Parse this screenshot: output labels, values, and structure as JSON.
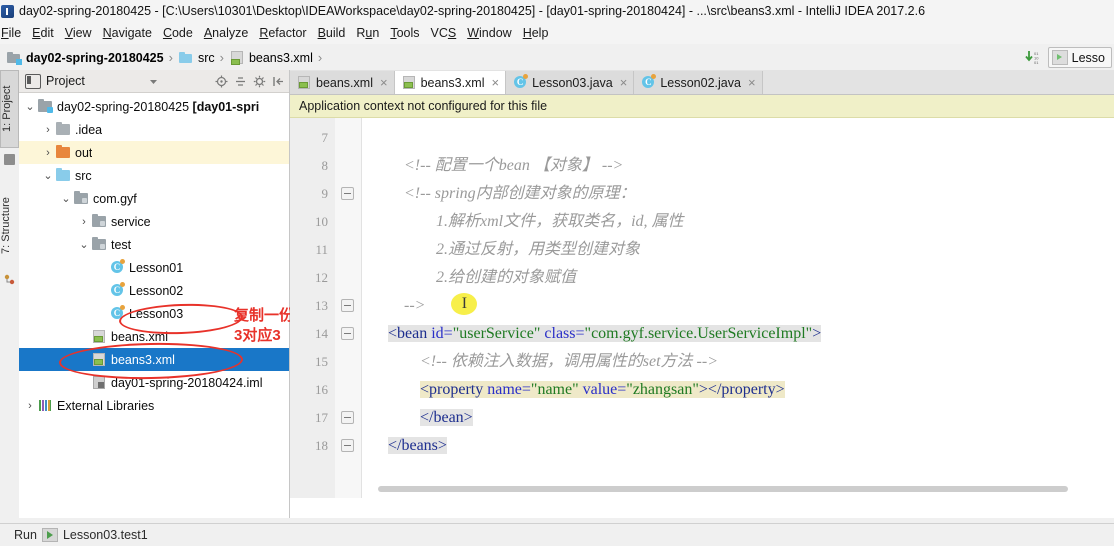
{
  "window": {
    "title": "day02-spring-20180425 - [C:\\Users\\10301\\Desktop\\IDEAWorkspace\\day02-spring-20180425] - [day01-spring-20180424] - ...\\src\\beans3.xml - IntelliJ IDEA 2017.2.6",
    "app_icon": "intellij-idea-icon"
  },
  "menubar": {
    "items": [
      {
        "label": "File",
        "mnemonic": "F"
      },
      {
        "label": "Edit",
        "mnemonic": "E"
      },
      {
        "label": "View",
        "mnemonic": "V"
      },
      {
        "label": "Navigate",
        "mnemonic": "N"
      },
      {
        "label": "Code",
        "mnemonic": "C"
      },
      {
        "label": "Analyze",
        "mnemonic": "A"
      },
      {
        "label": "Refactor",
        "mnemonic": "R"
      },
      {
        "label": "Build",
        "mnemonic": "B"
      },
      {
        "label": "Run",
        "mnemonic": "u"
      },
      {
        "label": "Tools",
        "mnemonic": "T"
      },
      {
        "label": "VCS",
        "mnemonic": "S"
      },
      {
        "label": "Window",
        "mnemonic": "W"
      },
      {
        "label": "Help",
        "mnemonic": "H"
      }
    ]
  },
  "navbar": {
    "crumbs": [
      {
        "label": "day02-spring-20180425",
        "icon": "module-icon",
        "bold": true
      },
      {
        "label": "src",
        "icon": "source-folder-icon",
        "bold": false
      },
      {
        "label": "beans3.xml",
        "icon": "xml-file-icon",
        "bold": false
      }
    ],
    "separator": "›",
    "run_config_label": "Lesso",
    "download_icon": "update-project-icon"
  },
  "left_strip": {
    "tabs": [
      {
        "label": "1: Project",
        "selected": true,
        "icon": "project-tool-icon"
      },
      {
        "label": "7: Structure",
        "selected": false,
        "icon": "structure-tool-icon"
      }
    ]
  },
  "project_panel": {
    "title": "Project",
    "title_icon": "project-view-icon",
    "dropdown_icon": "chevron-down-icon",
    "tools": [
      "locate-icon",
      "collapse-all-icon",
      "settings-gear-icon",
      "hide-panel-icon"
    ],
    "tree": [
      {
        "depth": 0,
        "arrow": "⌄",
        "icon": "module-icon",
        "label": "day02-spring-20180425 ",
        "bold_suffix": "[day01-spri",
        "state": "normal"
      },
      {
        "depth": 1,
        "arrow": "›",
        "icon": "folder-gray-icon",
        "label": ".idea",
        "state": "normal"
      },
      {
        "depth": 1,
        "arrow": "›",
        "icon": "folder-orange-icon",
        "label": "out",
        "state": "highlighted"
      },
      {
        "depth": 1,
        "arrow": "⌄",
        "icon": "folder-blue-icon",
        "label": "src",
        "state": "normal"
      },
      {
        "depth": 2,
        "arrow": "⌄",
        "icon": "package-icon",
        "label": "com.gyf",
        "state": "normal"
      },
      {
        "depth": 3,
        "arrow": "›",
        "icon": "package-icon",
        "label": "service",
        "state": "normal"
      },
      {
        "depth": 3,
        "arrow": "⌄",
        "icon": "package-icon",
        "label": "test",
        "state": "normal"
      },
      {
        "depth": 4,
        "arrow": "",
        "icon": "java-class-icon",
        "label": "Lesson01",
        "state": "normal"
      },
      {
        "depth": 4,
        "arrow": "",
        "icon": "java-class-icon",
        "label": "Lesson02",
        "state": "normal"
      },
      {
        "depth": 4,
        "arrow": "",
        "icon": "java-class-icon",
        "label": "Lesson03",
        "state": "normal"
      },
      {
        "depth": 3,
        "arrow": "",
        "icon": "xml-file-icon",
        "label": "beans.xml",
        "state": "normal"
      },
      {
        "depth": 3,
        "arrow": "",
        "icon": "xml-file-icon",
        "label": "beans3.xml",
        "state": "selected"
      },
      {
        "depth": 3,
        "arrow": "",
        "icon": "iml-file-icon",
        "label": "day01-spring-20180424.iml",
        "state": "normal"
      },
      {
        "depth": 0,
        "arrow": "›",
        "icon": "libraries-icon",
        "label": "External Libraries",
        "state": "normal"
      }
    ],
    "annotations": [
      {
        "text": "复制一份",
        "color": "#e8322a"
      },
      {
        "text": "3对应3",
        "color": "#e8322a"
      }
    ],
    "annotation_shapes": [
      "ellipse-around-lesson03",
      "ellipse-around-beans3xml"
    ]
  },
  "editor": {
    "tabs": [
      {
        "label": "beans.xml",
        "icon": "xml-file-icon",
        "active": false,
        "close": "×"
      },
      {
        "label": "beans3.xml",
        "icon": "xml-file-icon",
        "active": true,
        "close": "×"
      },
      {
        "label": "Lesson03.java",
        "icon": "java-class-icon",
        "active": false,
        "close": "×"
      },
      {
        "label": "Lesson02.java",
        "icon": "java-class-icon",
        "active": false,
        "close": "×"
      }
    ],
    "notice": "Application context not configured for this file",
    "notice_bg": "#f0f0c8",
    "line_numbers": [
      "7",
      "8",
      "9",
      "10",
      "11",
      "12",
      "13",
      "14",
      "15",
      "16",
      "17",
      "18"
    ],
    "lines": [
      {
        "num": "7",
        "indent": 0,
        "segments": []
      },
      {
        "num": "8",
        "indent": 2,
        "segments": [
          {
            "t": "<!-- 配置一个bean 【对象】 -->",
            "k": "com"
          }
        ]
      },
      {
        "num": "9",
        "indent": 2,
        "segments": [
          {
            "t": "<!-- spring内部创建对象的原理：",
            "k": "com"
          }
        ],
        "fold": true
      },
      {
        "num": "10",
        "indent": 4,
        "segments": [
          {
            "t": "1.解析xml文件，获取类名，id, 属性",
            "k": "com"
          }
        ]
      },
      {
        "num": "11",
        "indent": 4,
        "segments": [
          {
            "t": "2.通过反射，用类型创建对象",
            "k": "com"
          }
        ]
      },
      {
        "num": "12",
        "indent": 4,
        "segments": [
          {
            "t": "2.给创建的对象赋值",
            "k": "com"
          }
        ]
      },
      {
        "num": "13",
        "indent": 2,
        "segments": [
          {
            "t": "-->",
            "k": "com"
          }
        ],
        "caret": true,
        "fold": true
      },
      {
        "num": "14",
        "indent": 1,
        "segments": [
          {
            "t": "<bean ",
            "k": "tagname"
          },
          {
            "t": "id=",
            "k": "attr"
          },
          {
            "t": "\"userService\"",
            "k": "str"
          },
          {
            "t": " ",
            "k": "punct"
          },
          {
            "t": "class=",
            "k": "attr"
          },
          {
            "t": "\"com.gyf.service.UserServiceImpl\"",
            "k": "str"
          },
          {
            "t": ">",
            "k": "tagname"
          }
        ],
        "bg": "grey",
        "fold": true
      },
      {
        "num": "15",
        "indent": 3,
        "segments": [
          {
            "t": "<!-- 依赖注入数据，调用属性的set方法 -->",
            "k": "com"
          }
        ]
      },
      {
        "num": "16",
        "indent": 3,
        "segments": [
          {
            "t": "<property ",
            "k": "tagname"
          },
          {
            "t": "name=",
            "k": "attr"
          },
          {
            "t": "\"name\"",
            "k": "str"
          },
          {
            "t": " ",
            "k": "punct"
          },
          {
            "t": "value=",
            "k": "attr"
          },
          {
            "t": "\"zhangsan\"",
            "k": "str"
          },
          {
            "t": "></property>",
            "k": "tagname"
          }
        ],
        "bg": "soft"
      },
      {
        "num": "17",
        "indent": 3,
        "segments": [
          {
            "t": "</bean>",
            "k": "tagname"
          }
        ],
        "bg": "grey",
        "fold": true
      },
      {
        "num": "18",
        "indent": 1,
        "segments": [
          {
            "t": "</beans>",
            "k": "tagname"
          }
        ],
        "bg": "grey",
        "fold": true
      }
    ]
  },
  "statusbar": {
    "run_label": "Run",
    "run_icon": "run-tool-icon",
    "run_target": "Lesson03.test1"
  }
}
